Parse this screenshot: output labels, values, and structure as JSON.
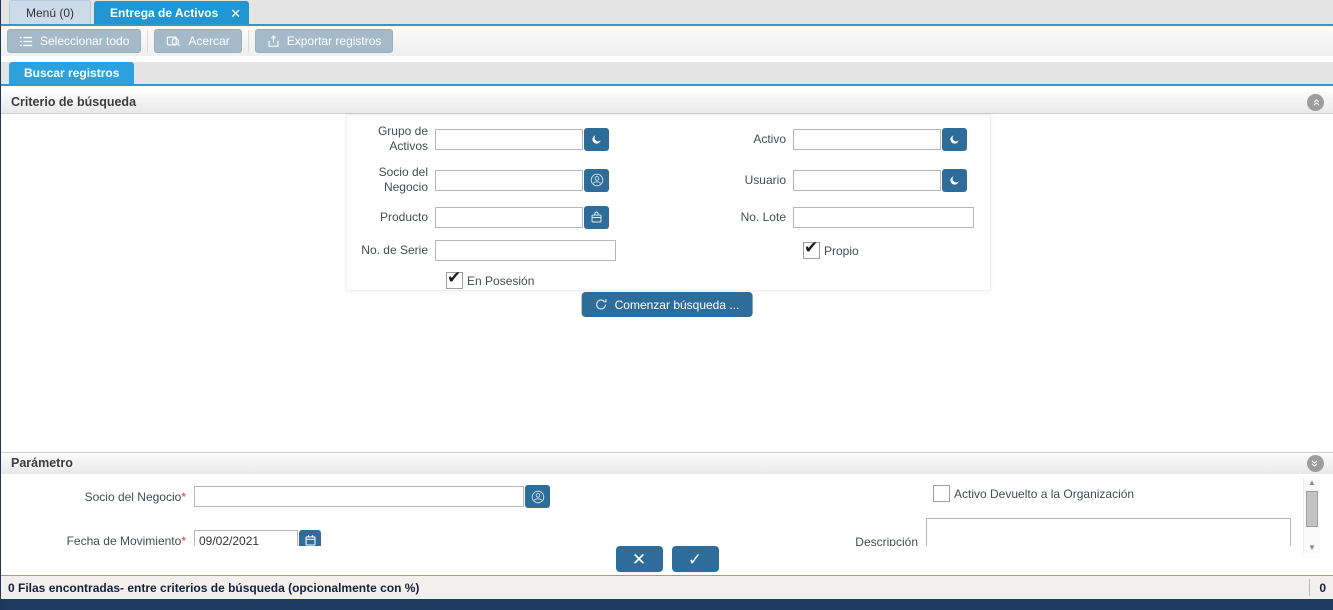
{
  "tabs": {
    "menu": "Menú (0)",
    "active": "Entrega de Activos"
  },
  "toolbar": {
    "select_all": "Seleccionar todo",
    "zoom": "Acercar",
    "export": "Exportar registros"
  },
  "subtab": "Buscar registros",
  "criteria": {
    "title": "Criterio de búsqueda",
    "labels": {
      "asset_group": "Grupo de Activos",
      "asset": "Activo",
      "bpartner": "Socio del Negocio",
      "user": "Usuario",
      "product": "Producto",
      "lot": "No. Lote",
      "serial": "No. de Serie",
      "owned": "Propio",
      "in_possession": "En Posesión"
    },
    "search_button": "Comenzar búsqueda ..."
  },
  "parameter": {
    "title": "Parámetro",
    "bpartner_label": "Socio del Negocio",
    "required_mark": "*",
    "movement_date_label": "Fecha de Movimiento",
    "movement_date_value": "09/02/2021",
    "returned_label": "Activo Devuelto a la Organización",
    "description_label": "Descripción"
  },
  "status": {
    "message": "0 Filas encontradas- entre criterios de búsqueda (opcionalmente con %)",
    "count": "0"
  },
  "icons": {
    "close": "✕",
    "check": "✔",
    "cancel_glyph": "✕",
    "confirm_glyph": "✓",
    "collapse_chevrons": "»",
    "scroll_up": "▲",
    "scroll_down": "▼"
  },
  "colors": {
    "accent_blue": "#2196d3",
    "button_blue": "#2e6d99",
    "toolbar_button": "#a5bac9",
    "navy": "#1d3a60"
  }
}
